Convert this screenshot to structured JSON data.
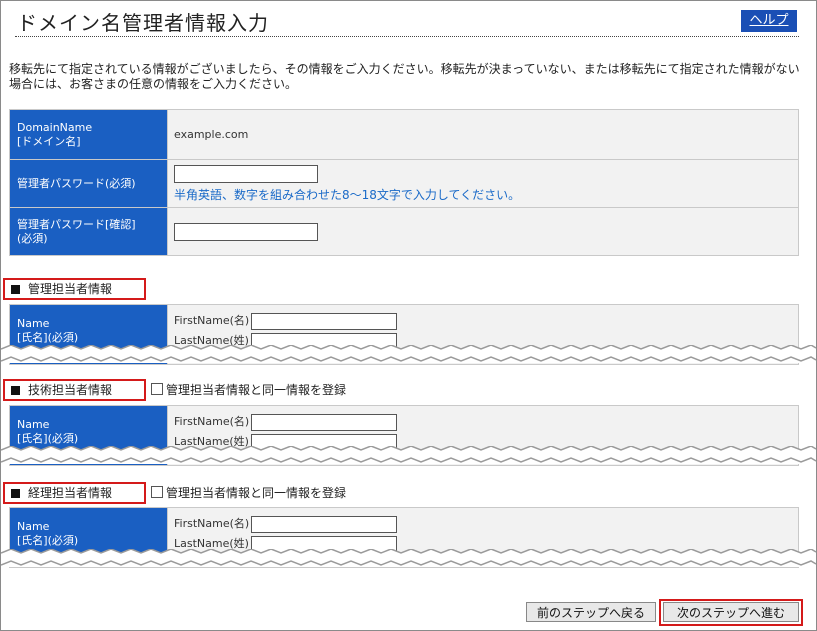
{
  "header": {
    "title": "ドメイン名管理者情報入力",
    "help_label": "ヘルプ"
  },
  "intro": "移転先にて指定されている情報がございましたら、その情報をご入力ください。移転先が決まっていない、または移転先にて指定された情報がない場合には、お客さまの任意の情報をご入力ください。",
  "domain_table": {
    "domain_label_1": "DomainName",
    "domain_label_2": "[ドメイン名]",
    "domain_value": "example.com",
    "password_label": "管理者パスワード(必須)",
    "password_value": "",
    "password_hint": "半角英語、数字を組み合わせた8～18文字で入力してください。",
    "confirm_label_1": "管理者パスワード[確認]",
    "confirm_label_2": "(必須)",
    "confirm_value": ""
  },
  "sections": {
    "admin": {
      "heading": "管理担当者情報"
    },
    "tech": {
      "heading": "技術担当者情報",
      "same_as_admin": "管理担当者情報と同一情報を登録",
      "same_checked": false
    },
    "billing": {
      "heading": "経理担当者情報",
      "same_as_admin": "管理担当者情報と同一情報を登録",
      "same_checked": false
    }
  },
  "name_fields": {
    "label_1": "Name",
    "label_2": "[氏名](必須)",
    "first_name_label": "FirstName(名)",
    "last_name_label": "LastName(姓)"
  },
  "nav": {
    "prev_label": "前のステップへ戻る",
    "next_label": "次のステップへ進む"
  },
  "colors": {
    "label_bg": "#1a5fc2",
    "help_bg": "#1a4fb5",
    "highlight_border": "#d41a1a",
    "hint_text": "#1a6ac8"
  }
}
